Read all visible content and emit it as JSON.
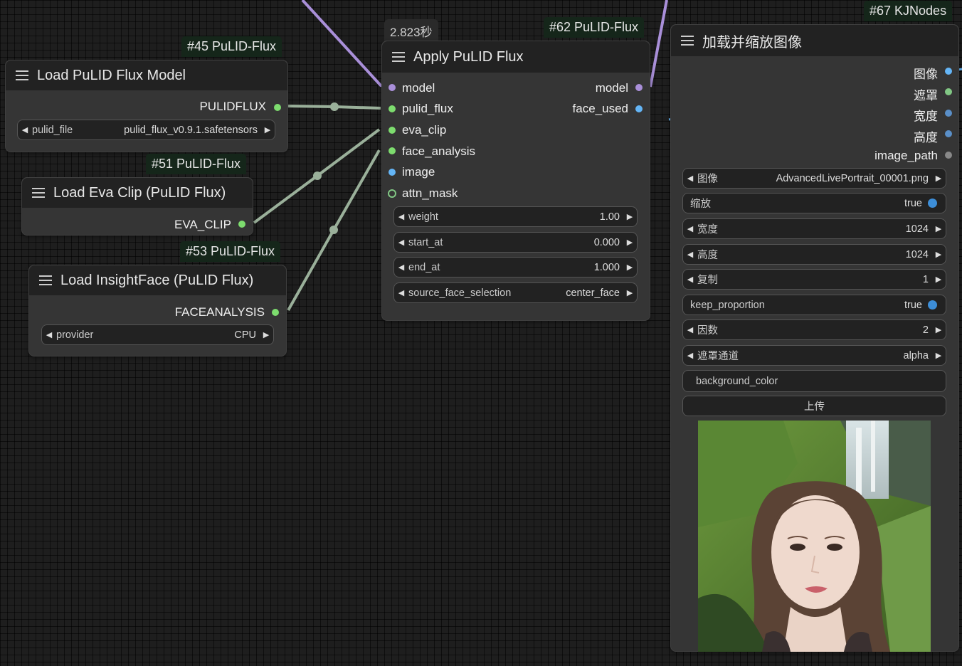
{
  "colors": {
    "model": "#a98fd9",
    "pulid_flux": "#9ab09a",
    "green_slot": "#7ddc6e",
    "image": "#64b5f6",
    "mask_slot": "#81c784",
    "badge_bg": "#15261a",
    "node_bg": "#353535",
    "header_bg": "#222222",
    "toggle_on": "#3d8ed8"
  },
  "node45": {
    "badge": "#45 PuLID-Flux",
    "title": "Load PuLID Flux Model",
    "output": "PULIDFLUX",
    "widget": {
      "name": "pulid_file",
      "value": "pulid_flux_v0.9.1.safetensors"
    }
  },
  "node51": {
    "badge": "#51 PuLID-Flux",
    "title": "Load Eva Clip (PuLID Flux)",
    "output": "EVA_CLIP"
  },
  "node53": {
    "badge": "#53 PuLID-Flux",
    "title": "Load InsightFace (PuLID Flux)",
    "output": "FACEANALYSIS",
    "widget": {
      "name": "provider",
      "value": "CPU"
    }
  },
  "node62": {
    "timing": "2.823秒",
    "badge": "#62 PuLID-Flux",
    "title": "Apply PuLID Flux",
    "inputs": [
      "model",
      "pulid_flux",
      "eva_clip",
      "face_analysis",
      "image",
      "attn_mask"
    ],
    "outputs": [
      "model",
      "face_used"
    ],
    "widgets": [
      {
        "name": "weight",
        "value": "1.00"
      },
      {
        "name": "start_at",
        "value": "0.000"
      },
      {
        "name": "end_at",
        "value": "1.000"
      },
      {
        "name": "source_face_selection",
        "value": "center_face"
      }
    ]
  },
  "node67": {
    "badge": "#67 KJNodes",
    "title": "加载并缩放图像",
    "outputs": [
      "图像",
      "遮罩",
      "宽度",
      "高度",
      "image_path"
    ],
    "widgets": [
      {
        "name": "图像",
        "value": "AdvancedLivePortrait_00001.png"
      },
      {
        "name": "缩放",
        "value": "true"
      },
      {
        "name": "宽度",
        "value": "1024"
      },
      {
        "name": "高度",
        "value": "1024"
      },
      {
        "name": "复制",
        "value": "1"
      },
      {
        "name": "keep_proportion",
        "value": "true"
      },
      {
        "name": "因数",
        "value": "2"
      },
      {
        "name": "遮罩通道",
        "value": "alpha"
      }
    ],
    "text_widget": "background_color",
    "upload_button": "上传"
  }
}
